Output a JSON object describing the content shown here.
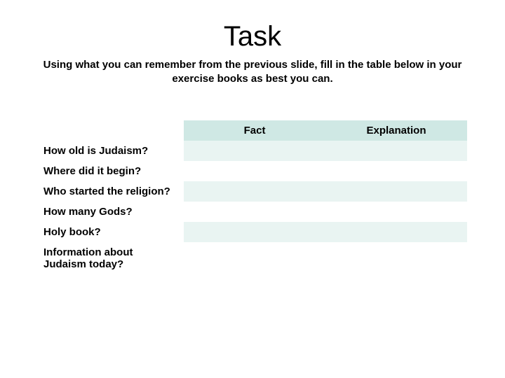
{
  "title": "Task",
  "instructions": "Using what you can remember from the previous slide, fill in the table below in your exercise books as best you can.",
  "table": {
    "headers": {
      "question": "",
      "fact": "Fact",
      "explanation": "Explanation"
    },
    "rows": [
      {
        "question": "How old is Judaism?",
        "fact": "",
        "explanation": ""
      },
      {
        "question": "Where did it begin?",
        "fact": "",
        "explanation": ""
      },
      {
        "question": "Who started the religion?",
        "fact": "",
        "explanation": ""
      },
      {
        "question": "How many Gods?",
        "fact": "",
        "explanation": ""
      },
      {
        "question": "Holy book?",
        "fact": "",
        "explanation": ""
      },
      {
        "question": "Information about Judaism today?",
        "fact": "",
        "explanation": ""
      }
    ]
  }
}
